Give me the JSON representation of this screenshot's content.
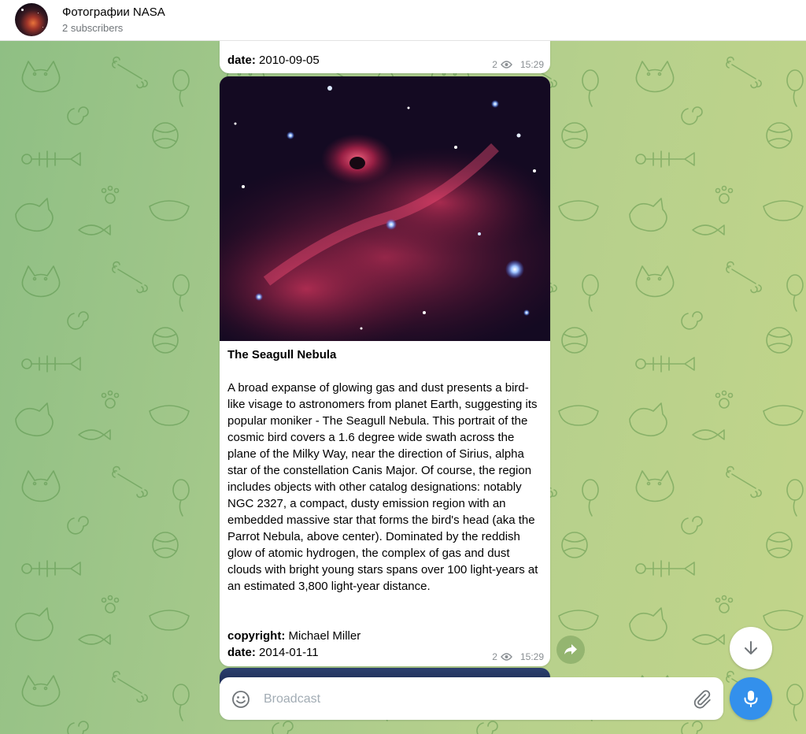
{
  "header": {
    "title": "Фотографии NASA",
    "subscribers": "2 subscribers"
  },
  "messages": [
    {
      "date_label": "date:",
      "date_value": "2010-09-05",
      "views": "2",
      "time": "15:29"
    },
    {
      "title": "The Seagull Nebula",
      "body": "A broad expanse of glowing gas and dust presents a bird-like visage to astronomers from planet Earth, suggesting its popular moniker - The Seagull Nebula. This portrait of the cosmic bird covers a 1.6 degree wide swath across the plane of the Milky Way, near the direction of Sirius, alpha star of the constellation Canis Major. Of course, the region includes objects with other catalog designations: notably NGC 2327, a compact, dusty emission region with an embedded massive star that forms the bird's head (aka the Parrot Nebula, above center). Dominated by the reddish glow of atomic hydrogen, the complex of gas and dust clouds with bright young stars spans over 100 light-years at an estimated 3,800 light-year distance.",
      "copyright_label": "copyright:",
      "copyright_value": "Michael Miller",
      "date_label": "date:",
      "date_value": "2014-01-11",
      "views": "2",
      "time": "15:29"
    }
  ],
  "composer": {
    "placeholder": "Broadcast"
  },
  "icons": {
    "avatar": "channel-avatar",
    "eye": "eye-icon",
    "forward": "forward-icon",
    "scroll_down": "arrow-down-icon",
    "emoji": "smile-icon",
    "attach": "paperclip-icon",
    "mic": "microphone-icon"
  },
  "colors": {
    "accent": "#3390ec",
    "meta_text": "#8a8f93",
    "chat_bg": "#a6c98b"
  }
}
